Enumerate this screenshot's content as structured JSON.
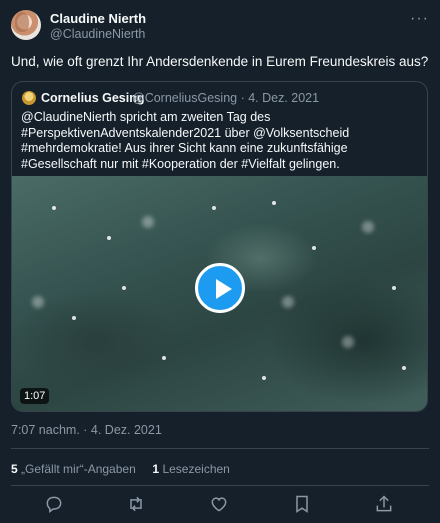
{
  "author": {
    "name": "Claudine Nierth",
    "handle": "@ClaudineNierth"
  },
  "more_label": "···",
  "tweet_text": "Und, wie oft grenzt Ihr Andersdenkende in Eurem Freundeskreis aus?",
  "quote": {
    "name": "Cornelius Gesing",
    "handle_date": "@CorneliusGesing · 4. Dez. 2021",
    "text": "@ClaudineNierth spricht am zweiten Tag des #PerspektivenAdventskalender2021 über @Volksentscheid #mehrdemokratie! Aus ihrer Sicht kann eine zukunftsfähige #Gesellschaft nur mit #Kooperation der #Vielfalt gelingen.",
    "video_duration": "1:07"
  },
  "timestamp": "7:07 nachm. · 4. Dez. 2021",
  "stats": {
    "likes_count": "5",
    "likes_label": "„Gefällt mir“-Angaben",
    "bookmarks_count": "1",
    "bookmarks_label": "Lesezeichen"
  },
  "actions": [
    "reply-icon",
    "retweet-icon",
    "like-icon",
    "bookmark-icon",
    "share-icon"
  ],
  "colors": {
    "background": "#15202b",
    "text": "#f7f9f9",
    "muted": "#8b98a5",
    "accent": "#1d9bf0",
    "border": "#38444d"
  }
}
